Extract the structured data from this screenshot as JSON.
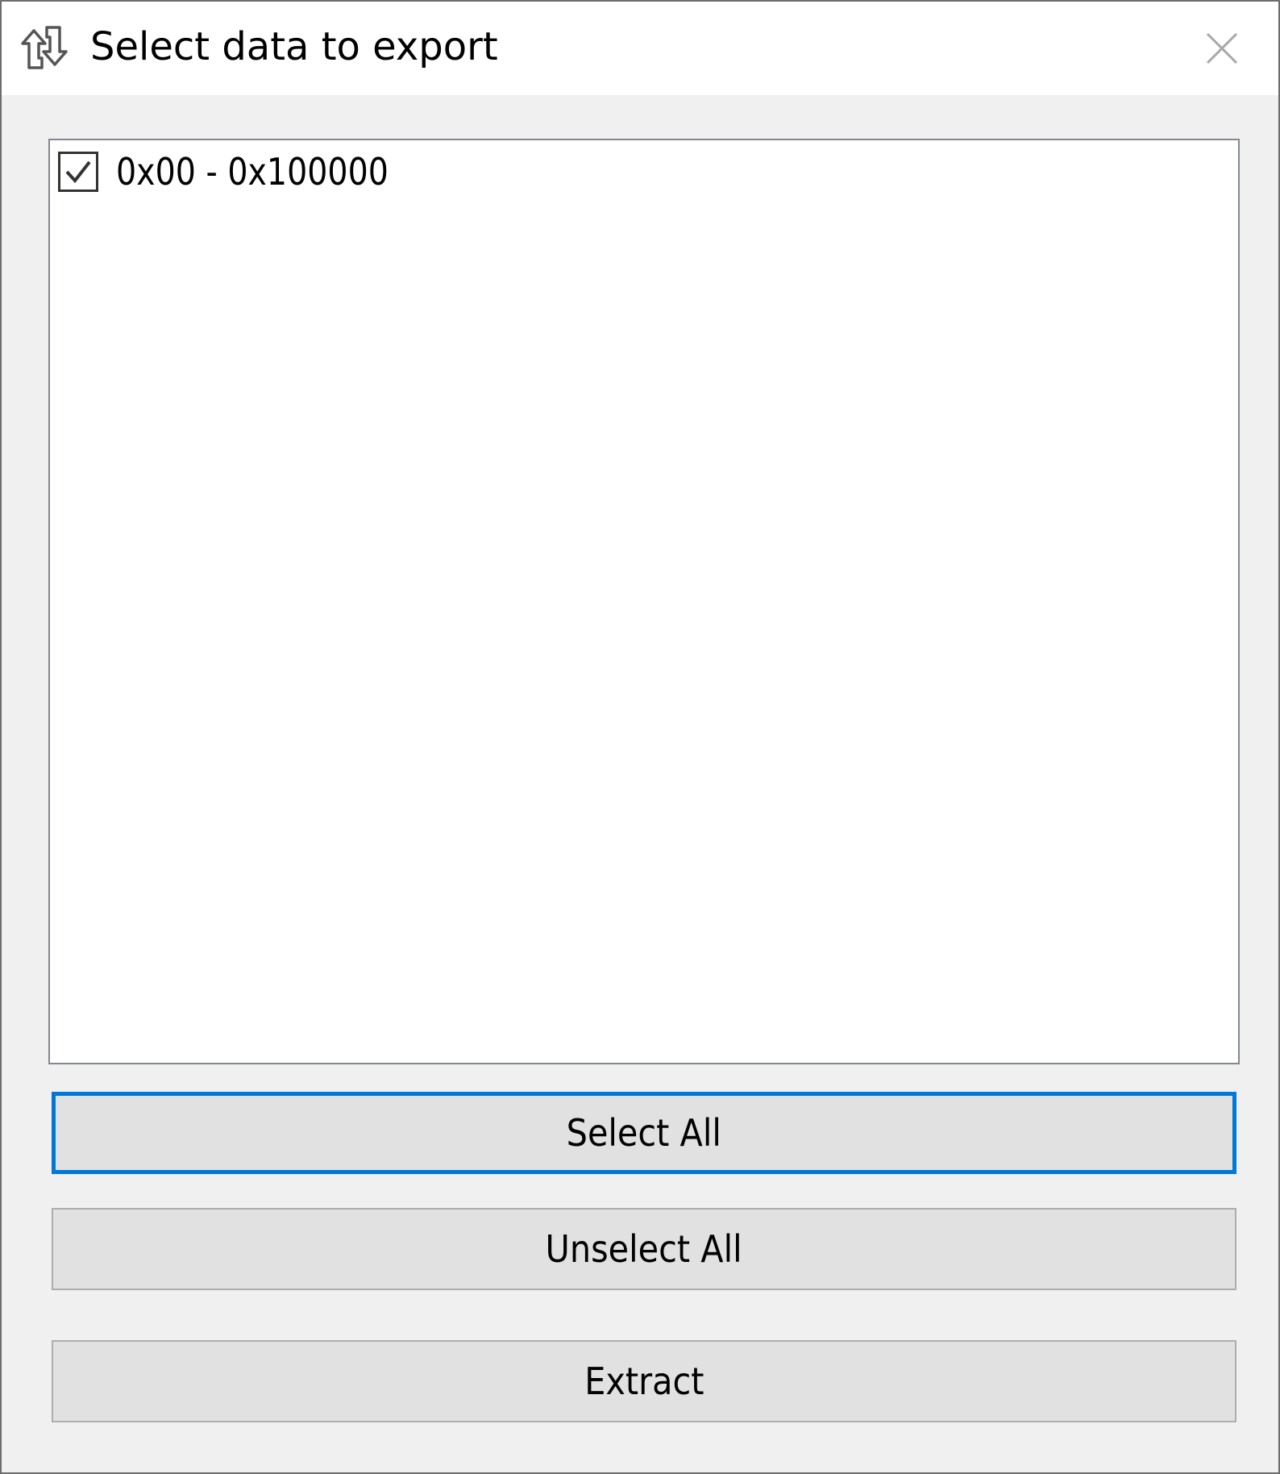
{
  "window": {
    "title": "Select data to export",
    "icon": "export-arrows-icon",
    "close_icon": "close-icon"
  },
  "list": {
    "items": [
      {
        "label": "0x00 - 0x100000",
        "checked": true
      }
    ]
  },
  "buttons": {
    "select_all": "Select All",
    "unselect_all": "Unselect All",
    "extract": "Extract"
  },
  "colors": {
    "focus_accent": "#0078d7",
    "button_face": "#e1e1e1",
    "window_bg": "#f0f0f0"
  }
}
